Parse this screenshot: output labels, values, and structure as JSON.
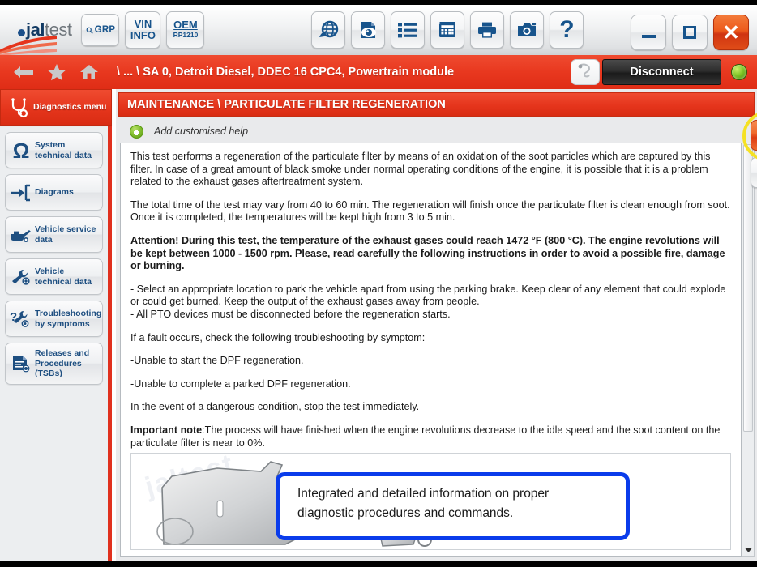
{
  "app": {
    "logo_mark": "jal",
    "logo_rest": "test"
  },
  "toolbar": {
    "grp_label": "GRP",
    "vin_line1": "VIN",
    "vin_line2": "INFO",
    "oem_line1": "OEM",
    "oem_line2": "RP1210",
    "icons": [
      {
        "name": "globe-icon",
        "title": "Web"
      },
      {
        "name": "document-preview-icon",
        "title": "Preview"
      },
      {
        "name": "list-icon",
        "title": "List"
      },
      {
        "name": "calculator-icon",
        "title": "Calculator"
      },
      {
        "name": "printer-icon",
        "title": "Print"
      },
      {
        "name": "camera-icon",
        "title": "Screenshot"
      },
      {
        "name": "help-question-icon",
        "title": "Help",
        "glyph": "?"
      }
    ]
  },
  "window_controls": {
    "minimize": "minimize-button",
    "maximize": "maximize-button",
    "close_glyph": "✕"
  },
  "breadcrumb": {
    "path": "\\ ... \\ SA 0, Detroit Diesel, DDEC 16 CPC4, Powertrain module",
    "back_icon": "back-arrow-icon",
    "favorite_icon": "star-icon",
    "home_icon": "home-icon"
  },
  "connection": {
    "plug_icon": "plug-icon",
    "disconnect_label": "Disconnect",
    "status": "connected-green"
  },
  "sidebar": {
    "items": [
      {
        "label": "Diagnostics menu",
        "icon": "stethoscope-icon",
        "active": true
      },
      {
        "label": "System technical data",
        "icon": "omega-icon",
        "active": false
      },
      {
        "label": "Diagrams",
        "icon": "signal-diagram-icon",
        "active": false
      },
      {
        "label": "Vehicle service data",
        "icon": "oil-can-icon",
        "active": false
      },
      {
        "label": "Vehicle technical data",
        "icon": "wrench-icon",
        "active": false
      },
      {
        "label": "Troubleshooting by symptoms",
        "icon": "question-wrench-icon",
        "active": false
      },
      {
        "label": "Releases and Procedures (TSBs)",
        "icon": "document-icon",
        "active": false
      }
    ]
  },
  "section": {
    "title": "MAINTENANCE \\ PARTICULATE FILTER REGENERATION",
    "add_help_label": "Add customised help",
    "add_help_icon": "green-plus-icon"
  },
  "document": {
    "paragraphs": [
      {
        "text": "This test performs a regeneration of the particulate filter by means of an oxidation of the soot particles which are captured by this filter. In case of a great amount of black smoke under normal operating conditions of the engine, it is possible that it is a problem related to the exhaust gases aftertreatment system.",
        "bold": false
      },
      {
        "text": "The total time of the test may vary from 40 to 60 min. The regeneration will finish once the particulate filter is clean enough from soot. Once it is completed, the temperatures will be kept high from 3 to 5 min.",
        "bold": false
      },
      {
        "text": "Attention! During this test, the temperature of the exhaust gases could reach 1472 °F (800 °C). The engine revolutions will be kept between 1000 - 1500 rpm. Please, read carefully the following instructions in order to avoid a possible fire, damage or burning.",
        "bold": true
      },
      {
        "text": "- Select an appropriate location to park the vehicle apart from using the parking brake. Keep clear of any element that could explode or could get burned. Keep the output of the exhaust gases away from people.",
        "bold": false,
        "tight": true
      },
      {
        "text": "- All PTO devices must be disconnected before the regeneration starts.",
        "bold": false
      },
      {
        "text": "If a fault occurs, check the following troubleshooting by symptom:",
        "bold": false
      },
      {
        "text": "-Unable to start the DPF regeneration.",
        "bold": false
      },
      {
        "text": "-Unable to complete a parked DPF regeneration.",
        "bold": false
      },
      {
        "text": "In the event of a dangerous condition, stop the test immediately.",
        "bold": false
      }
    ],
    "important_label": "Important note",
    "important_text": ":The process will have finished when the engine revolutions decrease to the idle speed and the soot content on the particulate filter is near to 0%.",
    "image_watermark": "jaltest",
    "image_info_icon": "info-i-icon"
  },
  "actions": {
    "confirm_icon": "checkmark-icon",
    "cancel_icon": "blue-x-icon",
    "highlight": "yellow-ellipse-highlight",
    "cursor": "mouse-pointer-icon"
  },
  "callout": {
    "line1": "Integrated and detailed information on proper",
    "line2": "diagnostic procedures and commands."
  },
  "colors": {
    "brand_red": "#e5351c",
    "brand_blue": "#1d4e80",
    "accent_orange": "#ef6a2c",
    "callout_blue": "#0a3ceb",
    "highlight_yellow": "#f5e124",
    "status_green": "#7dc425"
  }
}
